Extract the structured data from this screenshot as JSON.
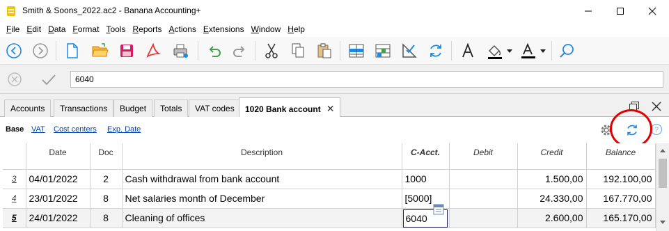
{
  "window": {
    "title": "Smith & Soons_2022.ac2 - Banana Accounting+",
    "icon": "banana-app-icon"
  },
  "menu": [
    {
      "label": "File",
      "ul": "F",
      "rest": "ile"
    },
    {
      "label": "Edit",
      "ul": "E",
      "rest": "dit"
    },
    {
      "label": "Data",
      "ul": "D",
      "rest": "ata"
    },
    {
      "label": "Format",
      "ul": "F",
      "rest": "ormat"
    },
    {
      "label": "Tools",
      "ul": "T",
      "rest": "ools"
    },
    {
      "label": "Reports",
      "ul": "R",
      "rest": "eports"
    },
    {
      "label": "Actions",
      "ul": "A",
      "rest": "ctions"
    },
    {
      "label": "Extensions",
      "ul": "E",
      "rest": "xtensions"
    },
    {
      "label": "Window",
      "ul": "W",
      "rest": "indow"
    },
    {
      "label": "Help",
      "ul": "H",
      "rest": "elp"
    }
  ],
  "input": {
    "value": "6040"
  },
  "tabs": [
    {
      "label": "Accounts"
    },
    {
      "label": "Transactions"
    },
    {
      "label": "Budget"
    },
    {
      "label": "Totals"
    },
    {
      "label": "VAT codes"
    },
    {
      "label": "1020 Bank account",
      "active": true
    }
  ],
  "views": [
    {
      "label": "Base",
      "selected": true
    },
    {
      "label": "VAT"
    },
    {
      "label": "Cost centers"
    },
    {
      "label": "Exp. Date"
    }
  ],
  "table": {
    "headers": {
      "row": "",
      "date": "Date",
      "doc": "Doc",
      "description": "Description",
      "cacct": "C-Acct.",
      "debit": "Debit",
      "credit": "Credit",
      "balance": "Balance"
    },
    "rows": [
      {
        "n": "3",
        "date": "04/01/2022",
        "doc": "2",
        "description": "Cash withdrawal from bank account",
        "cacct": "1000",
        "debit": "",
        "credit": "1.500,00",
        "balance": "192.100,00"
      },
      {
        "n": "4",
        "date": "23/01/2022",
        "doc": "8",
        "description": "Net salaries month of December",
        "cacct": "[5000]",
        "debit": "",
        "credit": "24.330,00",
        "balance": "167.770,00"
      },
      {
        "n": "5",
        "date": "24/01/2022",
        "doc": "8",
        "description": "Cleaning of offices",
        "cacct": "6040",
        "debit": "",
        "credit": "2.600,00",
        "balance": "165.170,00"
      }
    ]
  },
  "colors": {
    "highlight_circle": "#e00000",
    "accent_blue": "#1e88e5",
    "link": "#0645ad"
  }
}
